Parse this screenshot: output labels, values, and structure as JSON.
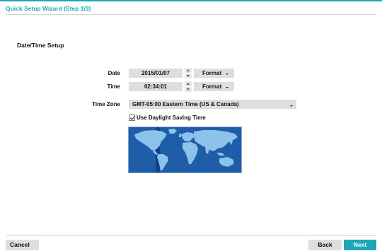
{
  "wizard": {
    "title": "Quick Setup Wizard (Step 1/3)",
    "section_title": "Date/Time Setup"
  },
  "date": {
    "label": "Date",
    "value": "2015/01/07",
    "format_label": "Format"
  },
  "time": {
    "label": "Time",
    "value": "02:34:01",
    "format_label": "Format"
  },
  "timezone": {
    "label": "Time Zone",
    "selected": "GMT-05:00  Eastern Time (US & Canada)"
  },
  "dst": {
    "label": "Use Daylight Saving Time",
    "checked": true
  },
  "map": {
    "icon": "world-map",
    "ocean_color": "#1e5da8",
    "land_color": "#8dc2ec",
    "highlight_color": "#15408a"
  },
  "footer": {
    "cancel_label": "Cancel",
    "back_label": "Back",
    "next_label": "Next"
  },
  "colors": {
    "accent": "#1ba8b8",
    "field_bg": "#dedede"
  }
}
